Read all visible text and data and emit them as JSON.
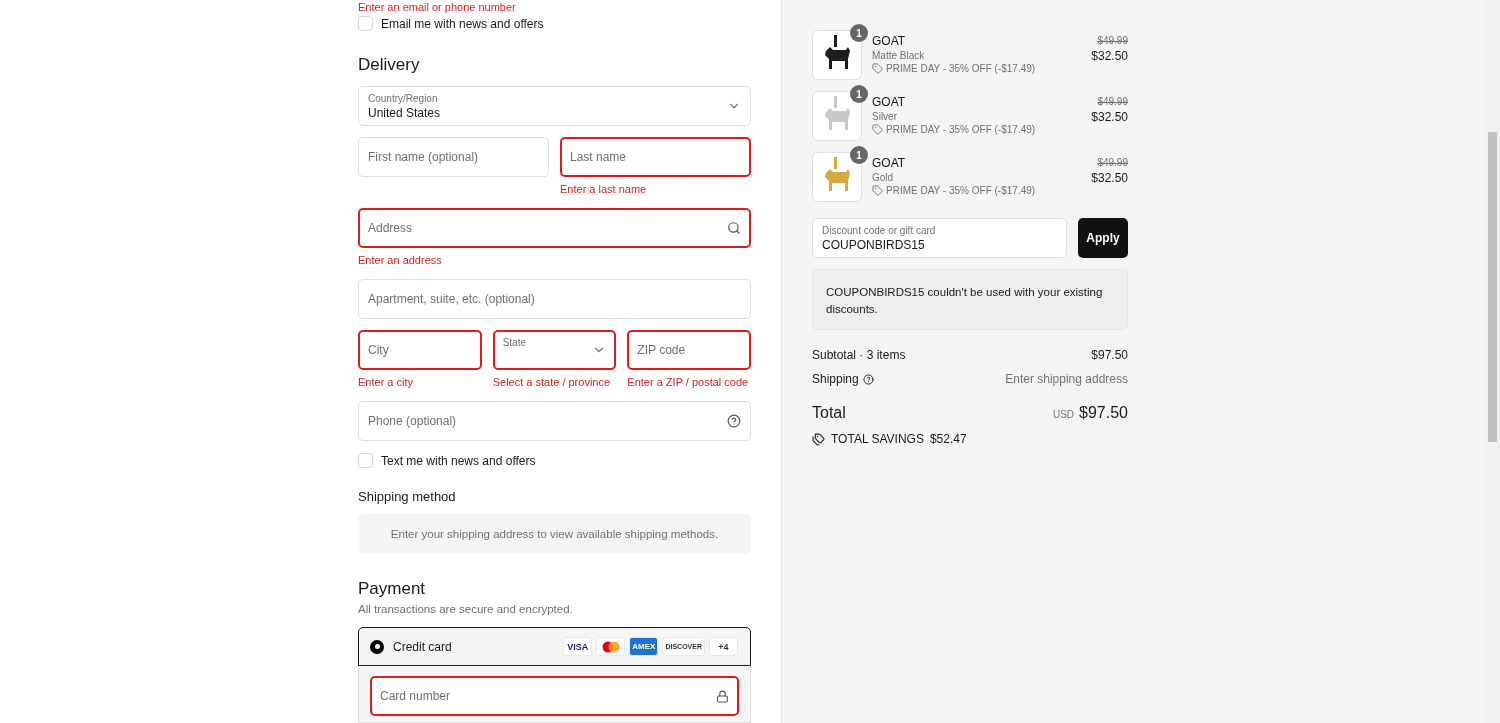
{
  "contact": {
    "error": "Enter an email or phone number",
    "email_optin": {
      "label": "Email me with news and offers",
      "checked": false
    }
  },
  "delivery": {
    "heading": "Delivery",
    "rows": [
      [
        {
          "kind": "select",
          "label": "Country/Region",
          "value": "United States",
          "invalid": false
        }
      ],
      [
        {
          "kind": "text",
          "placeholder": "First name (optional)",
          "invalid": false
        },
        {
          "kind": "text",
          "placeholder": "Last name",
          "invalid": true,
          "error": "Enter a last name"
        }
      ],
      [
        {
          "kind": "search",
          "placeholder": "Address",
          "invalid": true,
          "error": "Enter an address"
        }
      ],
      [
        {
          "kind": "text",
          "placeholder": "Apartment, suite, etc. (optional)",
          "invalid": false
        }
      ],
      [
        {
          "kind": "text",
          "placeholder": "City",
          "invalid": true,
          "error": "Enter a city"
        },
        {
          "kind": "select",
          "label": "State",
          "invalid": true,
          "error": "Select a state / province"
        },
        {
          "kind": "text",
          "placeholder": "ZIP code",
          "invalid": true,
          "error": "Enter a ZIP / postal code"
        }
      ],
      [
        {
          "kind": "help",
          "placeholder": "Phone (optional)",
          "invalid": false
        }
      ]
    ],
    "sms_optin": {
      "label": "Text me with news and offers",
      "checked": false
    }
  },
  "shipping_method": {
    "heading": "Shipping method",
    "notice": "Enter your shipping address to view available shipping methods."
  },
  "payment": {
    "heading": "Payment",
    "subtitle": "All transactions are secure and encrypted.",
    "method": {
      "label": "Credit card",
      "selected": true,
      "cards": [
        {
          "kind": "visa",
          "label": "VISA"
        },
        {
          "kind": "mastercard"
        },
        {
          "kind": "amex",
          "label": "AMEX"
        },
        {
          "kind": "discover",
          "label": "DISCOVER"
        },
        {
          "kind": "more",
          "label": "+4"
        }
      ]
    },
    "card_number": {
      "placeholder": "Card number",
      "invalid": true
    }
  },
  "summary": {
    "items": [
      {
        "name": "GOAT",
        "variant": "Matte Black",
        "quantity": "1",
        "color": "#1e1e1e",
        "discount": "PRIME DAY - 35% OFF (-$17.49)",
        "old_price": "$49.99",
        "price": "$32.50"
      },
      {
        "name": "GOAT",
        "variant": "Silver",
        "quantity": "1",
        "color": "#c8c8c8",
        "discount": "PRIME DAY - 35% OFF (-$17.49)",
        "old_price": "$49.99",
        "price": "$32.50"
      },
      {
        "name": "GOAT",
        "variant": "Gold",
        "quantity": "1",
        "color": "#d4aa3c",
        "discount": "PRIME DAY - 35% OFF (-$17.49)",
        "old_price": "$49.99",
        "price": "$32.50"
      }
    ],
    "discount_field": {
      "label": "Discount code or gift card",
      "value": "COUPONBIRDS15"
    },
    "apply": "Apply",
    "notice": "COUPONBIRDS15 couldn't be used with your existing discounts.",
    "subtotal": {
      "label": "Subtotal · 3 items",
      "value": "$97.50"
    },
    "shipping": {
      "label": "Shipping",
      "value": "Enter shipping address"
    },
    "total": {
      "label": "Total",
      "currency": "USD",
      "value": "$97.50"
    },
    "savings": {
      "label": "TOTAL SAVINGS",
      "value": "$52.47"
    }
  }
}
